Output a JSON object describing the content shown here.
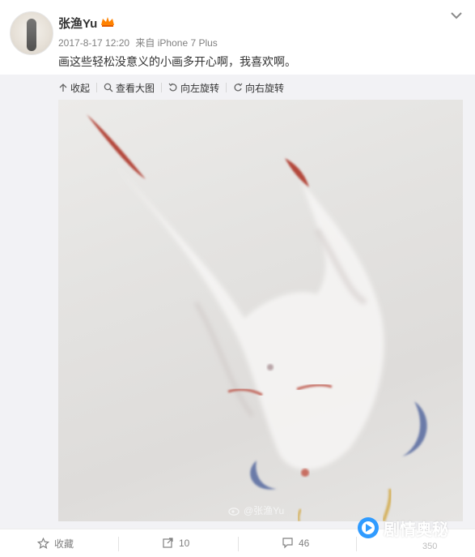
{
  "post": {
    "username": "张渔Yu",
    "date": "2017-8-17 12:20",
    "source": "来自 iPhone 7 Plus",
    "text": "画这些轻松没意义的小画多开心啊，我喜欢啊。"
  },
  "toolbar": {
    "collapse": "收起",
    "view_large": "查看大图",
    "rotate_left": "向左旋转",
    "rotate_right": "向右旋转"
  },
  "image": {
    "watermark": "@张渔Yu"
  },
  "actions": {
    "favorite": "收藏",
    "repost_count": "10",
    "comment_count": "46",
    "like_count": "350"
  },
  "overlay": {
    "brand": "剧情奥秘"
  },
  "colors": {
    "accent": "#ff8200",
    "brand_blue": "#2f9bff"
  }
}
